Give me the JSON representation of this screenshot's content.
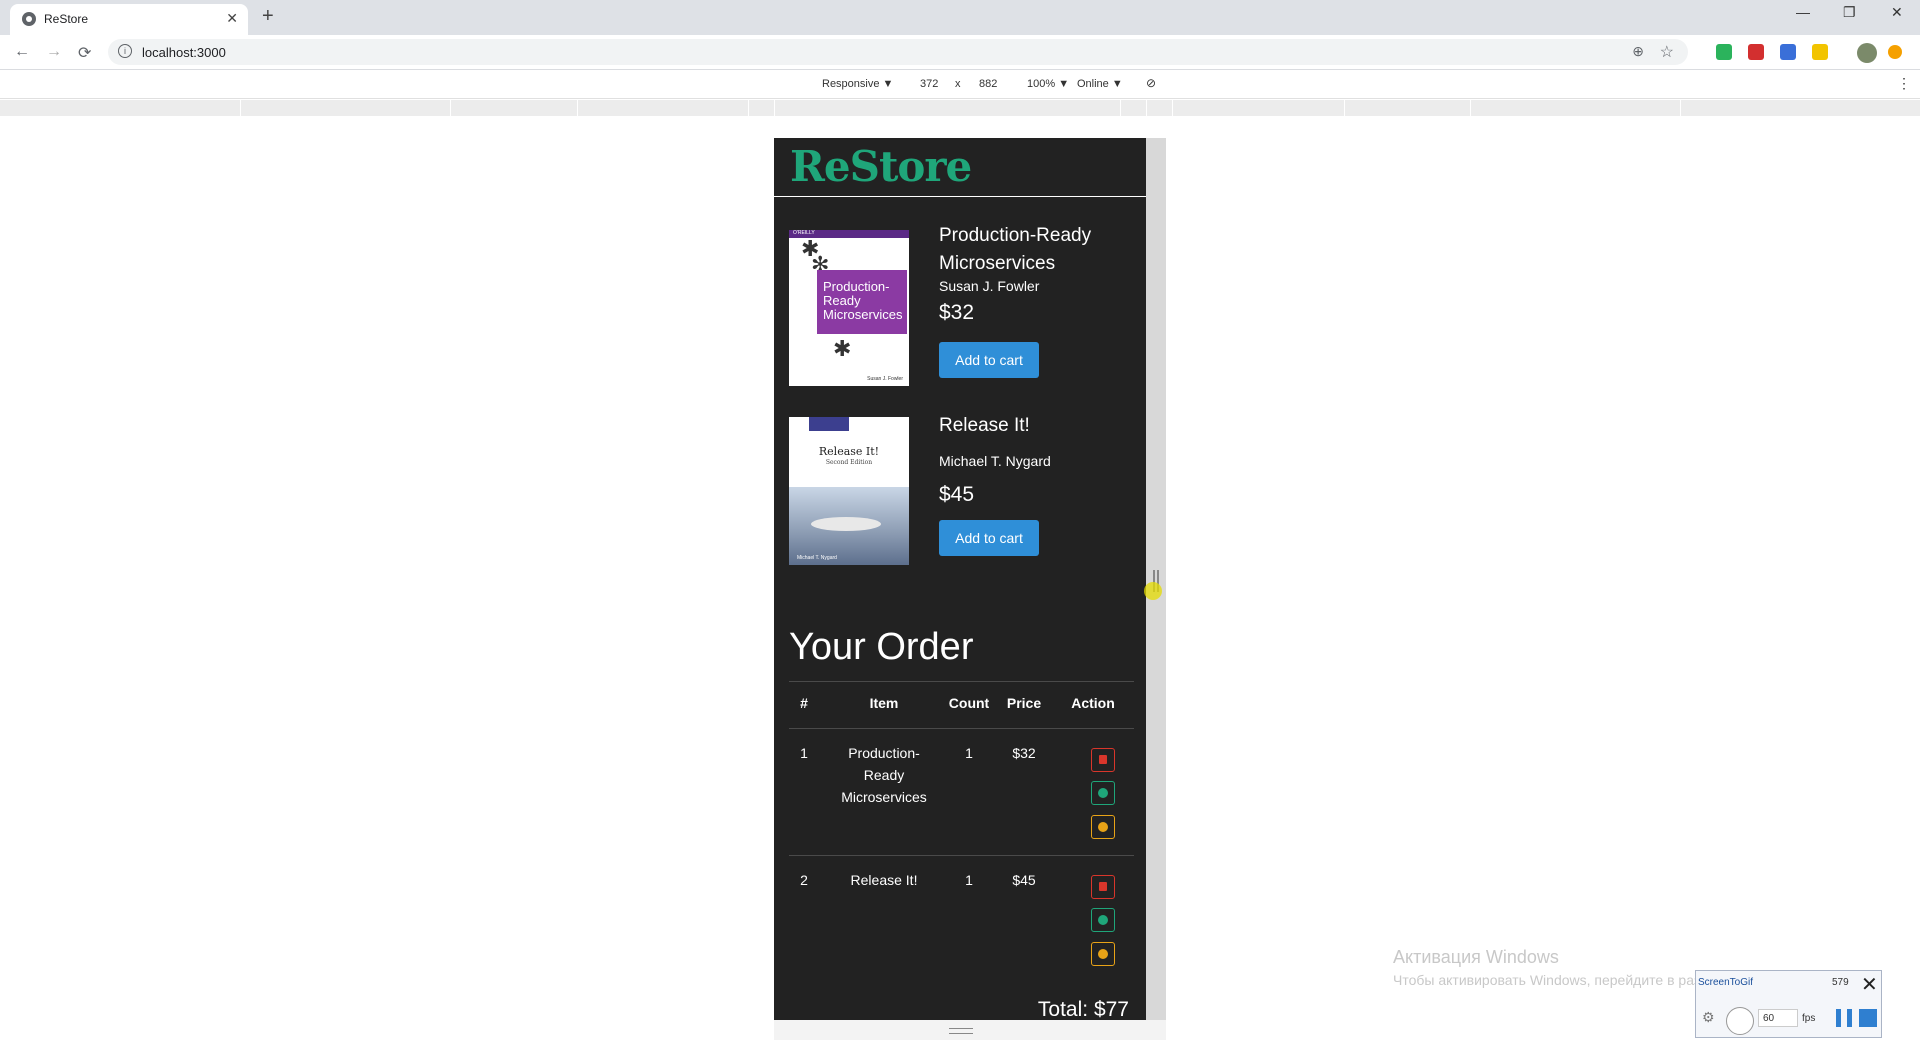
{
  "browser": {
    "tab_title": "ReStore",
    "tab_close": "✕",
    "new_tab": "+",
    "url": "localhost:3000",
    "window_controls": [
      "—",
      "❐",
      "✕"
    ]
  },
  "devtools": {
    "device": "Responsive ▼",
    "width": "372",
    "times": "x",
    "height": "882",
    "zoom": "100% ▼",
    "network": "Online ▼"
  },
  "app": {
    "brand": "ReStore",
    "products": [
      {
        "title": "Production-Ready Microservices",
        "author": "Susan J. Fowler",
        "price": "$32",
        "button": "Add to cart",
        "cover_text": "Production-Ready Microservices",
        "cover_publisher": "O'REILLY",
        "cover_author": "Susan J. Fowler"
      },
      {
        "title": "Release It!",
        "author": "Michael T. Nygard",
        "price": "$45",
        "button": "Add to cart",
        "cover_text": "Release It!",
        "cover_subtitle": "Second Edition",
        "cover_author": "Michael T. Nygard"
      }
    ],
    "order": {
      "heading": "Your Order",
      "columns": [
        "#",
        "Item",
        "Count",
        "Price",
        "Action"
      ],
      "rows": [
        {
          "num": "1",
          "item": "Production-Ready Microservices",
          "count": "1",
          "price": "$32"
        },
        {
          "num": "2",
          "item": "Release It!",
          "count": "1",
          "price": "$45"
        }
      ],
      "total": "Total: $77"
    }
  },
  "overlays": {
    "watermark_title": "Активация Windows",
    "watermark_text": "Чтобы активировать Windows, перейдите в раздел \"Параметры\".",
    "recorder_name": "ScreenToGif",
    "recorder_number": "579",
    "recorder_fps_value": "60",
    "recorder_fps_label": "fps"
  },
  "colors": {
    "brand": "#1fa67a",
    "button": "#2f8fd8",
    "background": "#222222",
    "delete": "#d9362b",
    "add": "#1fa67a",
    "remove": "#e8a317"
  }
}
